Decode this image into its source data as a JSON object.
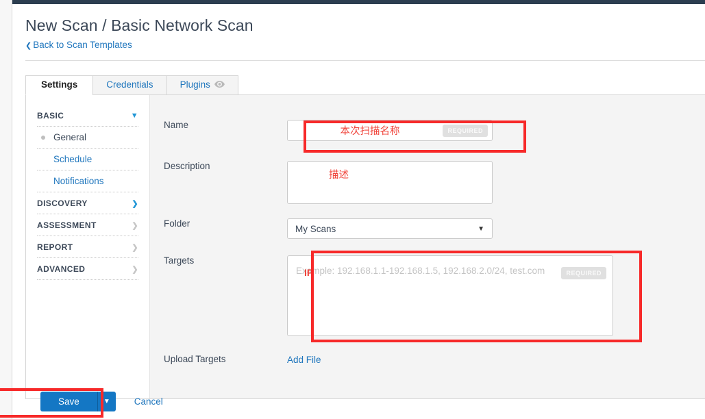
{
  "header": {
    "title": "New Scan / Basic Network Scan",
    "back_link": "Back to Scan Templates",
    "back_chevron": "chevron-left-icon"
  },
  "tabs": [
    {
      "label": "Settings",
      "active": true
    },
    {
      "label": "Credentials",
      "active": false
    },
    {
      "label": "Plugins",
      "active": false,
      "icon": "eye-icon"
    }
  ],
  "sidebar": {
    "groups": [
      {
        "label": "BASIC",
        "caret": "chevron-down-icon",
        "expanded": true,
        "items": [
          {
            "label": "General",
            "current": true
          },
          {
            "label": "Schedule",
            "current": false
          },
          {
            "label": "Notifications",
            "current": false
          }
        ]
      },
      {
        "label": "DISCOVERY",
        "caret": "chevron-right-icon",
        "expanded": false,
        "items": []
      },
      {
        "label": "ASSESSMENT",
        "caret": "chevron-right-icon",
        "expanded": false,
        "items": []
      },
      {
        "label": "REPORT",
        "caret": "chevron-right-icon",
        "expanded": false,
        "items": []
      },
      {
        "label": "ADVANCED",
        "caret": "chevron-right-icon",
        "expanded": false,
        "items": []
      }
    ]
  },
  "form": {
    "name": {
      "label": "Name",
      "value": "本次扫描名称",
      "required_badge": "REQUIRED",
      "annotated": true
    },
    "description": {
      "label": "Description",
      "value": "描述"
    },
    "folder": {
      "label": "Folder",
      "value": "My Scans",
      "caret": "chevron-down-icon"
    },
    "targets": {
      "label": "Targets",
      "placeholder": "Example: 192.168.1.1-192.168.1.5, 192.168.2.0/24, test.com",
      "annotation": "IP",
      "required_badge": "REQUIRED",
      "annotated": true
    },
    "upload_targets": {
      "label": "Upload Targets",
      "action": "Add File"
    }
  },
  "footer": {
    "save_label": "Save",
    "save_caret": "chevron-down-icon",
    "cancel_label": "Cancel"
  },
  "colors": {
    "link": "#1f76bd",
    "primary_button": "#1477c4",
    "annotation_red": "#f72929",
    "annotation_text_red": "#f0433a",
    "topbar": "#2c3e50",
    "panel_bg": "#f4f4f4"
  }
}
